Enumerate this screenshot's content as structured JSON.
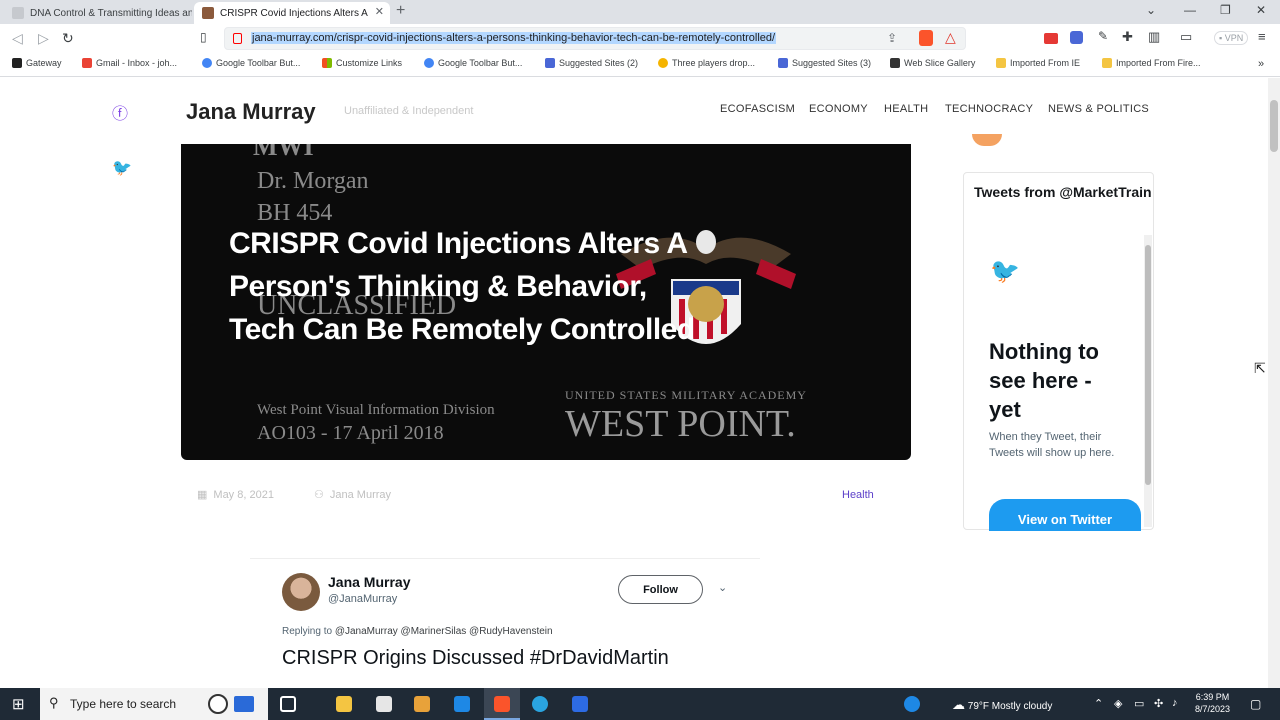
{
  "browser": {
    "tabs": [
      {
        "title": "DNA Control & Transmitting Ideas an",
        "active": false
      },
      {
        "title": "CRISPR Covid Injections Alters A",
        "active": true
      }
    ],
    "new_tab": "+",
    "url": "jana-murray.com/crispr-covid-injections-alters-a-persons-thinking-behavior-tech-can-be-remotely-controlled/",
    "vpn_label": "VPN",
    "bookmarks": [
      "Gateway",
      "Gmail - Inbox - joh...",
      "Google Toolbar But...",
      "Customize Links",
      "Google Toolbar But...",
      "Suggested Sites (2)",
      "Three players drop...",
      "Suggested Sites (3)",
      "Web Slice Gallery",
      "Imported From IE",
      "Imported From Fire..."
    ]
  },
  "site": {
    "title": "Jana Murray",
    "tagline": "Unaffiliated & Independent",
    "nav": [
      "ECOFASCISM",
      "ECONOMY",
      "HEALTH",
      "TECHNOCRACY",
      "NEWS & POLITICS"
    ]
  },
  "hero": {
    "bg_lines": [
      "MWI",
      "Dr. Morgan",
      "BH 454",
      "UNCLASSIFIED",
      "West Point Visual Information Division",
      "AO103 -    17 April 2018",
      "UNITED STATES MILITARY ACADEMY",
      "WEST POINT."
    ],
    "title": "CRISPR Covid Injections Alters A Person's Thinking & Behavior, Tech Can Be Remotely Controlled"
  },
  "post_meta": {
    "date": "May 8, 2021",
    "author": "Jana Murray",
    "category": "Health"
  },
  "twitter_widget": {
    "title": "Tweets from @MarketTrain",
    "empty_heading": "Nothing to see here - yet",
    "empty_text": "When they Tweet, their Tweets will show up here.",
    "button": "View on Twitter"
  },
  "embedded_tweet": {
    "name": "Jana Murray",
    "handle": "@JanaMurray",
    "follow": "Follow",
    "replying_label": "Replying to",
    "replying_to": "@JanaMurray @MarinerSilas @RudyHavenstein",
    "text": "CRISPR Origins Discussed #DrDavidMartin"
  },
  "taskbar": {
    "search_placeholder": "Type here to search",
    "weather": "79°F  Mostly cloudy",
    "time": "6:39 PM",
    "date": "8/7/2023"
  },
  "colors": {
    "accent": "#7b3fe4",
    "twitter_blue": "#1d9bf0",
    "category": "#5b3fc9"
  }
}
